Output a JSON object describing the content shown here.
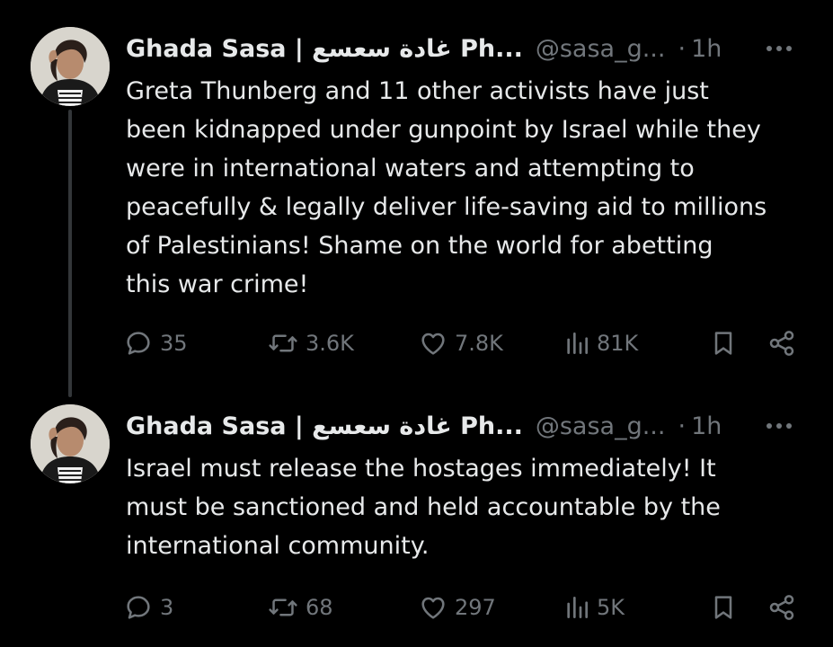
{
  "tweets": [
    {
      "author": {
        "display_name": "Ghada Sasa | غادة سعسع Ph...",
        "handle": "@sasa_g..."
      },
      "separator": "·",
      "time": "1h",
      "text_lines": [
        "Greta Thunberg and 11 other activists have just",
        "been kidnapped under gunpoint by Israel while they",
        "were in international waters and attempting to",
        "peacefully & legally deliver life-saving aid to millions",
        "of Palestinians! Shame on the world for abetting",
        "this war crime!"
      ],
      "stats": {
        "replies": "35",
        "reposts": "3.6K",
        "likes": "7.8K",
        "views": "81K"
      }
    },
    {
      "author": {
        "display_name": "Ghada Sasa | غادة سعسع Ph...",
        "handle": "@sasa_g..."
      },
      "separator": "·",
      "time": "1h",
      "text_lines": [
        "Israel must release the hostages immediately! It",
        "must be sanctioned and held accountable by the",
        "international community."
      ],
      "stats": {
        "replies": "3",
        "reposts": "68",
        "likes": "297",
        "views": "5K"
      }
    }
  ],
  "icons": {
    "more": "more-horizontal-icon",
    "reply": "reply-bubble-icon",
    "repost": "repost-arrows-icon",
    "like": "heart-icon",
    "views": "views-bar-chart-icon",
    "bookmark": "bookmark-icon",
    "share": "share-icon"
  },
  "colors": {
    "background": "#000000",
    "primary_text": "#e7e9ea",
    "secondary_text": "#71767b",
    "thread_line": "#333639"
  }
}
